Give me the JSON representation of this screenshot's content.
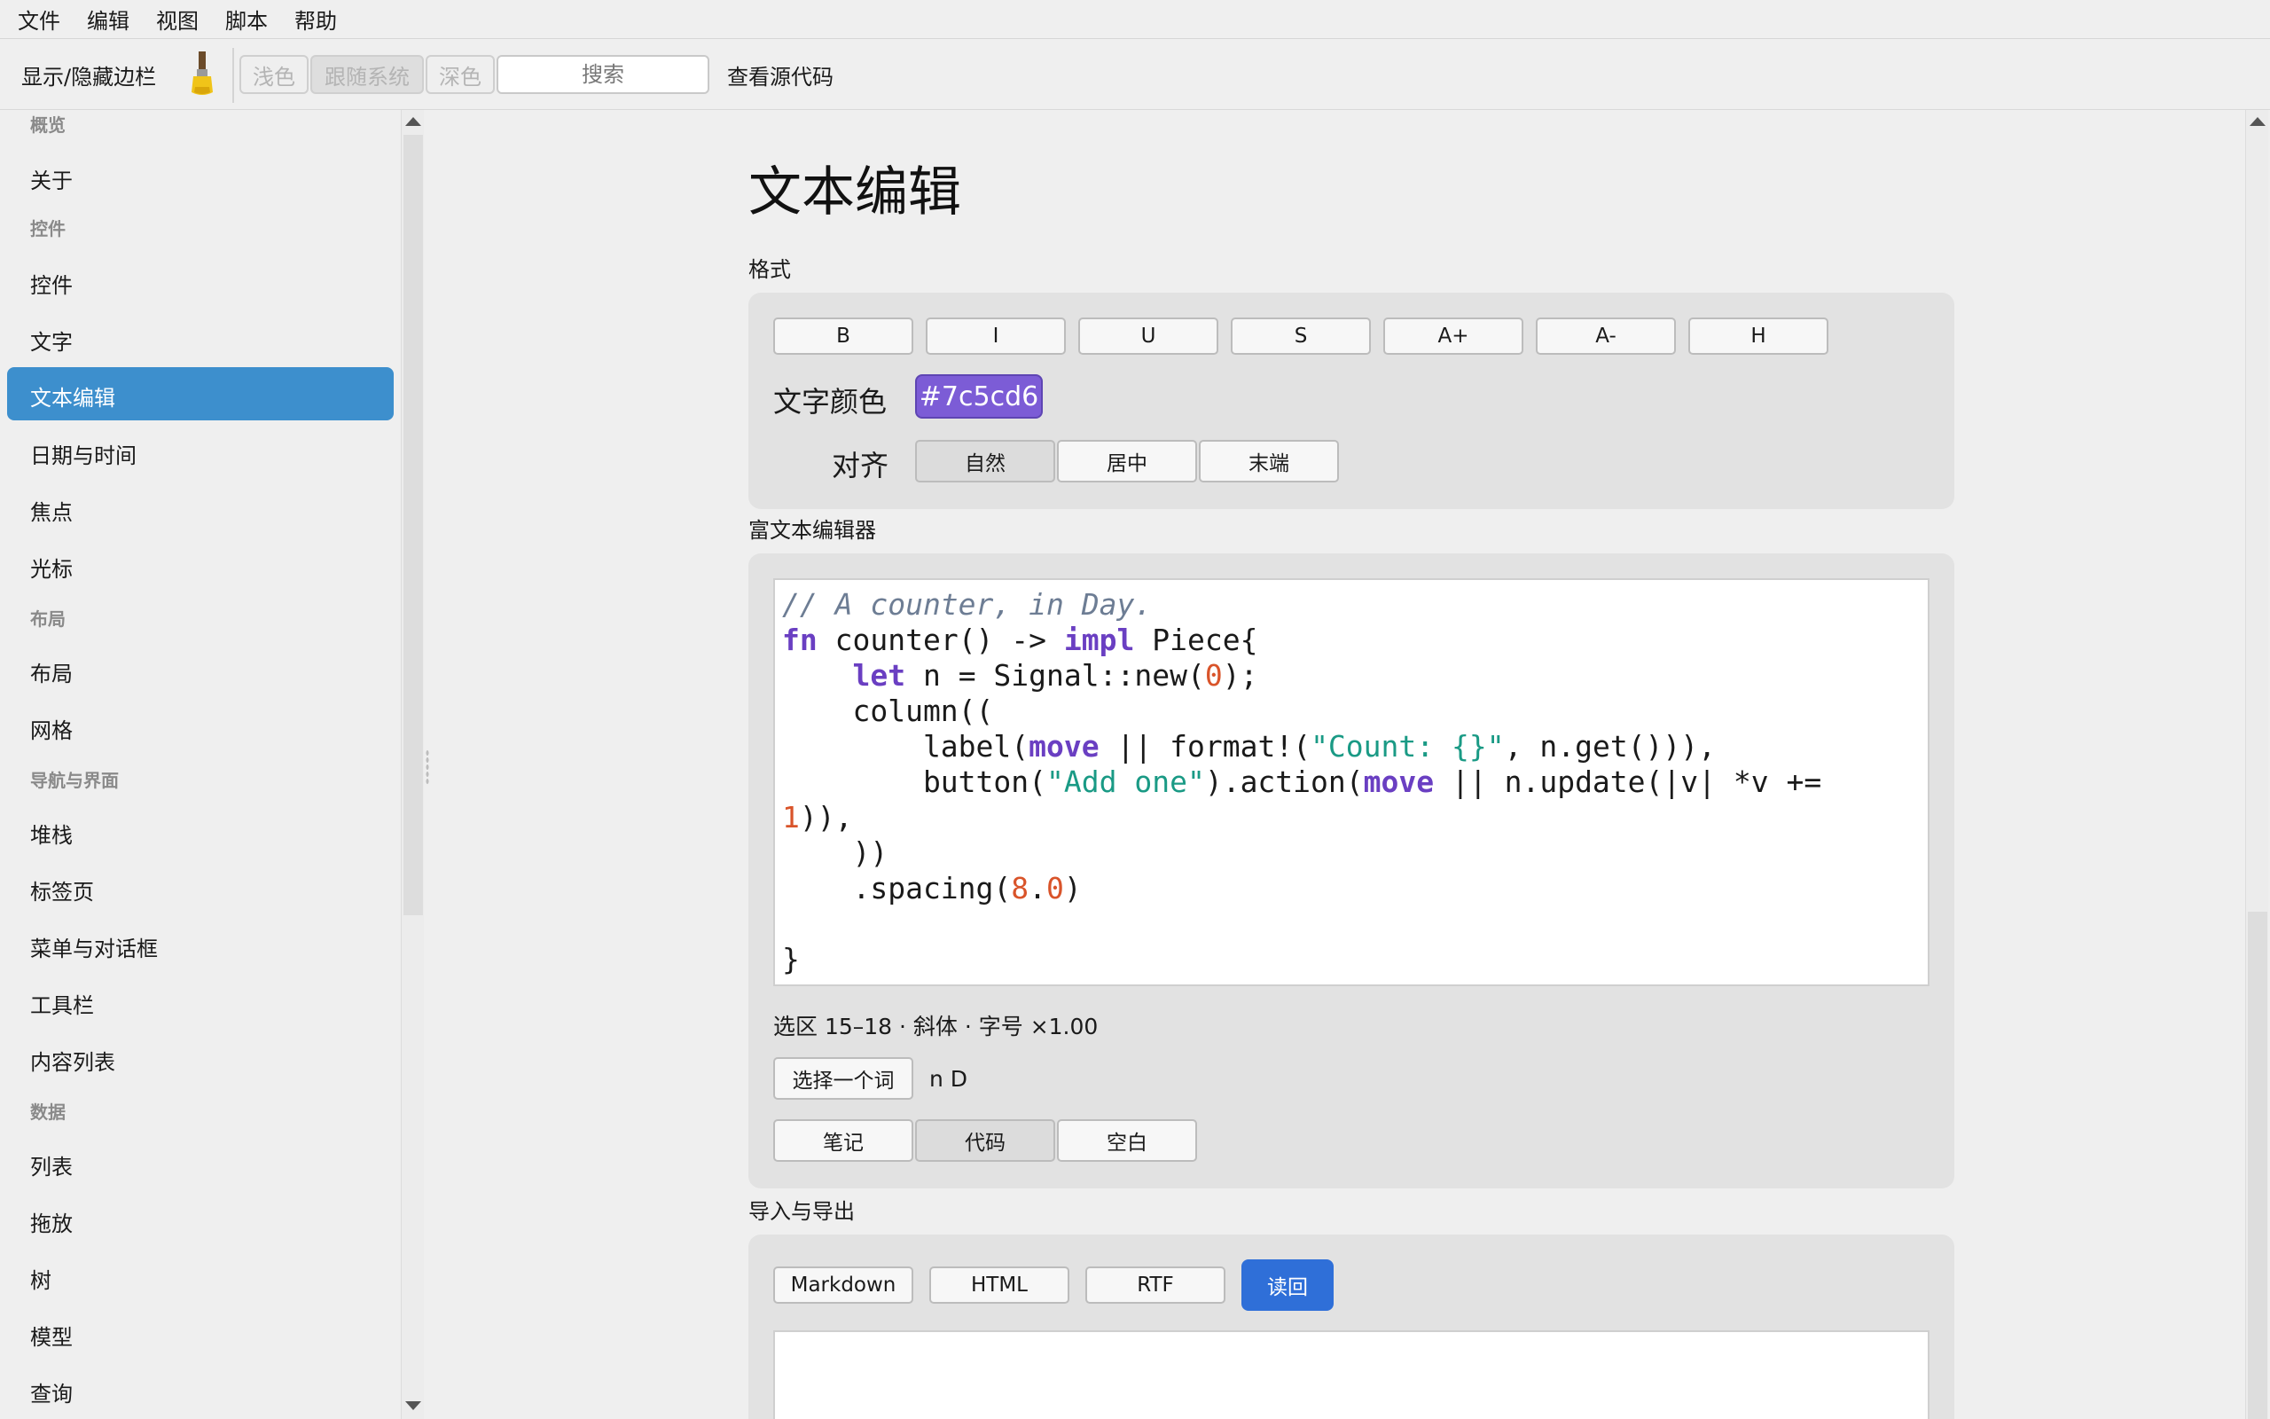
{
  "menubar": [
    "文件",
    "编辑",
    "视图",
    "脚本",
    "帮助"
  ],
  "toolbar": {
    "toggle_sidebar": "显示/隐藏边栏",
    "theme_light": "浅色",
    "theme_system": "跟随系统",
    "theme_dark": "深色",
    "search_placeholder": "搜索",
    "view_source": "查看源代码"
  },
  "sidebar": {
    "sections": {
      "overview": "概览",
      "controls": "控件",
      "layout": "布局",
      "nav": "导航与界面",
      "data": "数据"
    },
    "items": {
      "about": "关于",
      "controls": "控件",
      "text": "文字",
      "text_edit": "文本编辑",
      "datetime": "日期与时间",
      "focus": "焦点",
      "cursor": "光标",
      "layout": "布局",
      "grid": "网格",
      "stack": "堆栈",
      "tabs": "标签页",
      "menus": "菜单与对话框",
      "toolbar": "工具栏",
      "content_list": "内容列表",
      "list": "列表",
      "dragdrop": "拖放",
      "tree": "树",
      "model": "模型",
      "query": "查询"
    },
    "selected": "text_edit"
  },
  "page": {
    "title": "文本编辑",
    "format_label": "格式",
    "format_buttons": [
      "B",
      "I",
      "U",
      "S",
      "A+",
      "A-",
      "H"
    ],
    "text_color_label": "文字颜色",
    "text_color_value": "#7c5cd6",
    "align_label": "对齐",
    "align_buttons": [
      "自然",
      "居中",
      "末端"
    ],
    "align_selected": "自然",
    "rich_editor_label": "富文本编辑器",
    "status": "选区 15–18 · 斜体 · 字号 ×1.00",
    "select_word_button": "选择一个词",
    "selection_preview": "n D",
    "preset_buttons": [
      "笔记",
      "代码",
      "空白"
    ],
    "preset_selected": "代码",
    "io_label": "导入与导出",
    "io_buttons": [
      "Markdown",
      "HTML",
      "RTF"
    ],
    "read_back_button": "读回"
  },
  "code": {
    "line1": "// A counter, in Day.",
    "kw_fn": "fn",
    "line2_rest": " counter() -> ",
    "kw_impl": "impl",
    "line2_end": " Piece{",
    "indent1": "    ",
    "kw_let": "let",
    "line3_mid": " n = Signal::new(",
    "num_0": "0",
    "line3_end": ");",
    "line4": "    column((",
    "line5_start": "        label(",
    "kw_move": "move",
    "line5_mid": " || format!(",
    "str_count": "\"Count: {}\"",
    "line5_end": ", n.get())),",
    "line6_start": "        button(",
    "str_add": "\"Add one\"",
    "line6_mid": ").action(",
    "line6_end": " || n.update(|v| *v +=",
    "num_1": "1",
    "line7_end": ")),",
    "line8": "    ))",
    "line9_start": "    .spacing(",
    "num_8": "8",
    "dot": ".",
    "line9_end": ")",
    "line11": "}"
  },
  "colors": {
    "accent": "#3d8fcd",
    "primary_button": "#2f6fd8",
    "text_color_chip": "#7c5cd6"
  },
  "icons": {
    "brush": "paint-brush-icon"
  }
}
